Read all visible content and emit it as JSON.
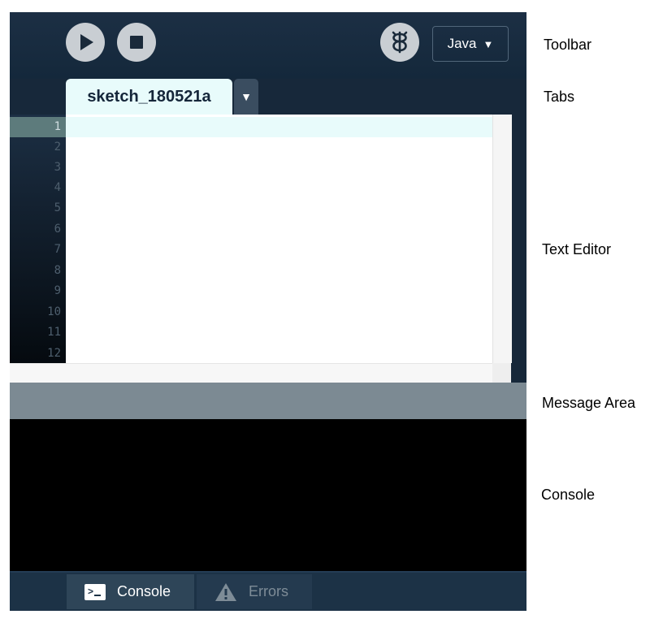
{
  "toolbar": {
    "mode_label": "Java",
    "mode_arrow": "▼",
    "icons": [
      "play-icon",
      "stop-icon",
      "debug-icon"
    ]
  },
  "tabs": {
    "active_tab": "sketch_180521a",
    "menu_arrow": "▼"
  },
  "editor": {
    "line_numbers": [
      "1",
      "2",
      "3",
      "4",
      "5",
      "6",
      "7",
      "8",
      "9",
      "10",
      "11",
      "12"
    ],
    "current_line": 1
  },
  "footer": {
    "console_label": "Console",
    "errors_label": "Errors"
  },
  "callouts": {
    "toolbar": "Toolbar",
    "tabs": "Tabs",
    "text_editor": "Text Editor",
    "message_area": "Message Area",
    "console": "Console"
  },
  "colors": {
    "toolbar_bg": "#17283a",
    "tab_bg": "#e8fbfb",
    "message_area": "#7c8a93",
    "console_bg": "#000000"
  }
}
